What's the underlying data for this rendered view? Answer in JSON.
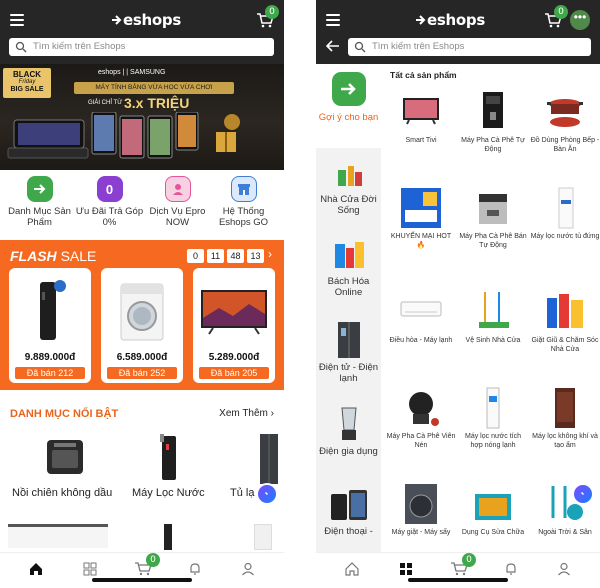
{
  "left": {
    "brand": "eshops",
    "cart_count": "0",
    "search_placeholder": "Tìm kiếm trên Eshops",
    "banner": {
      "badge_line1": "BLACK",
      "badge_line2": "Friday",
      "badge_line3": "BIG SALE",
      "logos": "eshops | | SAMSUNG",
      "headline": "MÁY TÍNH BẢNG VỪA HỌC VỪA CHƠI",
      "subline": "GIẢI CHỈ TỪ",
      "price": "3.x TRIỆU"
    },
    "quick_links": [
      {
        "label": "Danh Mục Sản Phẩm",
        "icon": "arrow-right-icon",
        "color": "#3ea84b"
      },
      {
        "label": "Ưu Đãi Trả Góp 0%",
        "icon": "zero-percent-icon",
        "color": "#8b3fd1"
      },
      {
        "label": "Dịch Vụ Epro NOW",
        "icon": "person-icon",
        "color": "#e5559a"
      },
      {
        "label": "Hệ Thống Eshops GO",
        "icon": "store-icon",
        "color": "#3e7fd6"
      }
    ],
    "flash_sale": {
      "title_bold": "FLASH",
      "title_rest": "SALE",
      "timer": [
        "0",
        "11",
        "48",
        "13"
      ],
      "arrow": "›",
      "items": [
        {
          "price": "9.889.000đ",
          "sold": "Đã bán 212",
          "icon": "water-purifier-icon"
        },
        {
          "price": "6.589.000đ",
          "sold": "Đã bán 252",
          "icon": "washing-machine-icon"
        },
        {
          "price": "5.289.000đ",
          "sold": "Đã bán 205",
          "icon": "tv-icon"
        }
      ]
    },
    "featured": {
      "title": "DANH MỤC NỔI BẬT",
      "see_more": "Xem Thêm ›",
      "categories": [
        "Nồi chiên không dầu",
        "Máy Lọc Nước",
        "Tủ lạ"
      ]
    }
  },
  "right": {
    "brand": "eshops",
    "cart_count": "0",
    "search_placeholder": "Tìm kiếm trên Eshops",
    "sidebar": [
      {
        "label": "Gợi ý cho bạn",
        "icon": "arrow-right-icon"
      },
      {
        "label": "Nhà Cửa Đời Sống",
        "icon": "household-icon"
      },
      {
        "label": "Bách Hóa Online",
        "icon": "grocery-icon"
      },
      {
        "label": "Điện tử - Điện lạnh",
        "icon": "fridge-icon"
      },
      {
        "label": "Điện gia dụng",
        "icon": "blender-icon"
      },
      {
        "label": "Điện thoại -",
        "icon": "phone-icon"
      }
    ],
    "grid_title": "Tất cả sản phẩm",
    "products": [
      {
        "label": "Smart Tivi",
        "icon": "tv-icon"
      },
      {
        "label": "Máy Pha Cà Phê Tự Động",
        "icon": "coffee-machine-icon"
      },
      {
        "label": "Đồ Dùng Phòng Bếp - Bàn Ăn",
        "icon": "cookware-icon"
      },
      {
        "label": "KHUYẾN MẠI HOT 🔥",
        "icon": "promo-icon"
      },
      {
        "label": "Máy Pha Cà Phê Bán Tự Động",
        "icon": "espresso-icon"
      },
      {
        "label": "Máy lọc nước tủ đứng",
        "icon": "water-purifier-icon"
      },
      {
        "label": "Điều hòa - Máy lạnh",
        "icon": "air-conditioner-icon"
      },
      {
        "label": "Vệ Sinh Nhà Cửa",
        "icon": "mop-icon"
      },
      {
        "label": "Giặt Giũ & Chăm Sóc Nhà Cửa",
        "icon": "detergent-icon"
      },
      {
        "label": "Máy Pha Cà Phê Viên Nén",
        "icon": "capsule-machine-icon"
      },
      {
        "label": "Máy lọc nước tích hợp nóng lạnh",
        "icon": "dispenser-icon"
      },
      {
        "label": "Máy lọc không khí và tạo ẩm",
        "icon": "air-purifier-icon"
      },
      {
        "label": "Máy giặt - Máy sấy",
        "icon": "washing-machine-icon"
      },
      {
        "label": "Dụng Cụ Sửa Chữa",
        "icon": "toolbox-icon"
      },
      {
        "label": "Ngoài Trời & Sân",
        "icon": "garden-tools-icon"
      }
    ]
  }
}
